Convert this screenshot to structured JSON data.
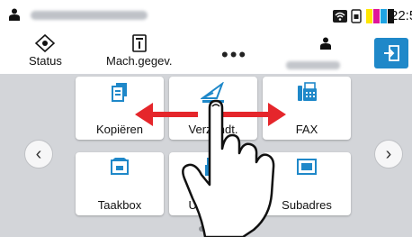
{
  "statusbar": {
    "user_icon": "user-icon",
    "account_name": "",
    "icons": [
      "wifi-icon",
      "phone-icon",
      "toner-level-icon"
    ],
    "toner_colors": [
      "#ffe600",
      "#e0169b",
      "#1fa3e3",
      "#111111"
    ],
    "clock": "22:5"
  },
  "toolbar": {
    "status_label": "Status",
    "machine_label": "Mach.gegev.",
    "more_label": "•••",
    "logout_icon": "logout-icon"
  },
  "main": {
    "nav_prev": "‹",
    "nav_next": "›",
    "tiles": [
      {
        "label": "Kopiëren",
        "icon": "copy-icon"
      },
      {
        "label": "Verzendt.",
        "icon": "send-icon"
      },
      {
        "label": "FAX",
        "icon": "fax-icon"
      },
      {
        "label": "Taakbox",
        "icon": "job-box-icon"
      },
      {
        "label": "USB-stati",
        "icon": "usb-icon"
      },
      {
        "label": "Subadres",
        "icon": "sub-address-icon"
      }
    ],
    "page_dots": 2,
    "active_page": 1
  },
  "overlay": {
    "gesture": "swipe-hand",
    "arrow_color": "#e5262b"
  },
  "colors": {
    "accent": "#1f88c9",
    "background": "#d3d5d9",
    "tile": "#ffffff"
  }
}
